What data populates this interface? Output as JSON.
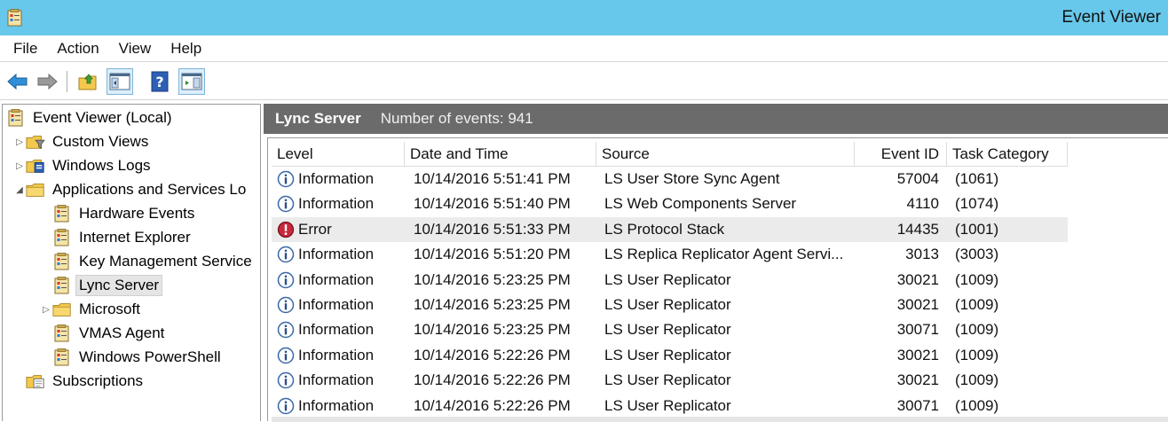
{
  "window": {
    "title": "Event Viewer"
  },
  "menu": [
    "File",
    "Action",
    "View",
    "Help"
  ],
  "toolbar": {
    "icons": [
      "back-arrow-icon",
      "forward-arrow-icon",
      "up-folder-icon",
      "show-hide-tree-icon",
      "help-icon",
      "show-hide-action-pane-icon"
    ]
  },
  "tree": {
    "items": [
      {
        "label": "Event Viewer (Local)",
        "indent": 0,
        "twisty": "",
        "icon": "event-viewer-icon"
      },
      {
        "label": "Custom Views",
        "indent": 1,
        "twisty": "▷",
        "icon": "folder-filter-icon"
      },
      {
        "label": "Windows Logs",
        "indent": 1,
        "twisty": "▷",
        "icon": "folder-log-icon"
      },
      {
        "label": "Applications and Services Lo",
        "indent": 1,
        "twisty": "◢",
        "icon": "folder-icon"
      },
      {
        "label": "Hardware Events",
        "indent": 2,
        "twisty": "",
        "icon": "log-icon"
      },
      {
        "label": "Internet Explorer",
        "indent": 2,
        "twisty": "",
        "icon": "log-icon"
      },
      {
        "label": "Key Management Service",
        "indent": 2,
        "twisty": "",
        "icon": "log-icon"
      },
      {
        "label": "Lync Server",
        "indent": 2,
        "twisty": "",
        "icon": "log-icon",
        "selected": true
      },
      {
        "label": "Microsoft",
        "indent": 2,
        "twisty": "▷",
        "icon": "folder-icon"
      },
      {
        "label": "VMAS Agent",
        "indent": 2,
        "twisty": "",
        "icon": "log-icon"
      },
      {
        "label": "Windows PowerShell",
        "indent": 2,
        "twisty": "",
        "icon": "log-icon"
      },
      {
        "label": "Subscriptions",
        "indent": 1,
        "twisty": "",
        "icon": "subscriptions-icon"
      }
    ]
  },
  "pane": {
    "title": "Lync Server",
    "count": "Number of events: 941"
  },
  "columns": {
    "level": "Level",
    "date": "Date and Time",
    "source": "Source",
    "event_id": "Event ID",
    "task": "Task Category"
  },
  "events": [
    {
      "level": "Information",
      "type": "info",
      "date": "10/14/2016 5:51:41 PM",
      "source": "LS User Store Sync Agent",
      "id": "57004",
      "task": "(1061)"
    },
    {
      "level": "Information",
      "type": "info",
      "date": "10/14/2016 5:51:40 PM",
      "source": "LS Web Components Server",
      "id": "4110",
      "task": "(1074)"
    },
    {
      "level": "Error",
      "type": "error",
      "date": "10/14/2016 5:51:33 PM",
      "source": "LS Protocol Stack",
      "id": "14435",
      "task": "(1001)"
    },
    {
      "level": "Information",
      "type": "info",
      "date": "10/14/2016 5:51:20 PM",
      "source": "LS Replica Replicator Agent Servi...",
      "id": "3013",
      "task": "(3003)"
    },
    {
      "level": "Information",
      "type": "info",
      "date": "10/14/2016 5:23:25 PM",
      "source": "LS User Replicator",
      "id": "30021",
      "task": "(1009)"
    },
    {
      "level": "Information",
      "type": "info",
      "date": "10/14/2016 5:23:25 PM",
      "source": "LS User Replicator",
      "id": "30021",
      "task": "(1009)"
    },
    {
      "level": "Information",
      "type": "info",
      "date": "10/14/2016 5:23:25 PM",
      "source": "LS User Replicator",
      "id": "30071",
      "task": "(1009)"
    },
    {
      "level": "Information",
      "type": "info",
      "date": "10/14/2016 5:22:26 PM",
      "source": "LS User Replicator",
      "id": "30021",
      "task": "(1009)"
    },
    {
      "level": "Information",
      "type": "info",
      "date": "10/14/2016 5:22:26 PM",
      "source": "LS User Replicator",
      "id": "30021",
      "task": "(1009)"
    },
    {
      "level": "Information",
      "type": "info",
      "date": "10/14/2016 5:22:26 PM",
      "source": "LS User Replicator",
      "id": "30071",
      "task": "(1009)"
    }
  ]
}
